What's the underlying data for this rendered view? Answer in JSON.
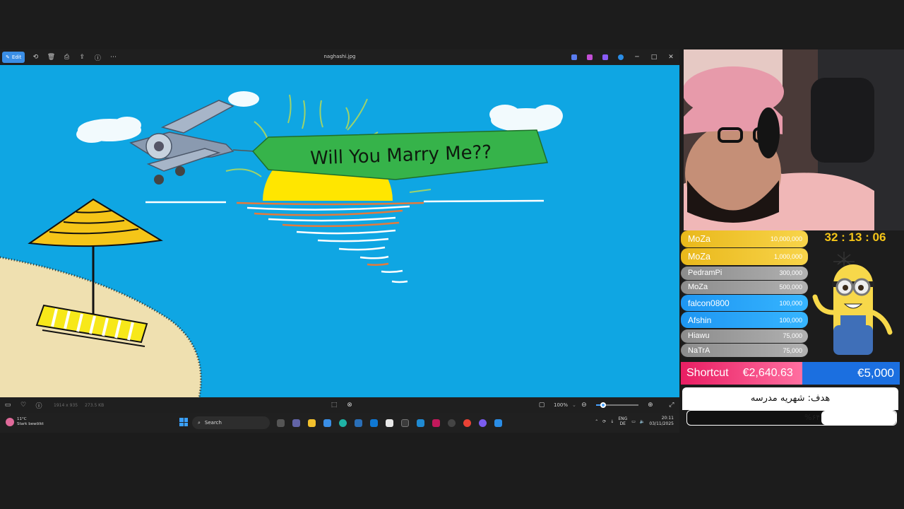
{
  "photos": {
    "edit_label": "Edit",
    "filename": "naghashi.jpg",
    "toolbar_icons": [
      "rotate-icon",
      "delete-icon",
      "print-icon",
      "share-icon",
      "info-icon",
      "more-icon"
    ],
    "window_controls": {
      "minimize": "─",
      "maximize": "□",
      "close": "✕"
    }
  },
  "drawing": {
    "banner_text": "Will You Marry Me??",
    "colors": {
      "sky": "#0fa6e3",
      "sun": "#ffe600",
      "banner": "#36b34a",
      "sand": "#efe0b0"
    }
  },
  "statusbar": {
    "dimensions": "1914 x 935",
    "filesize": "273.5 KB",
    "zoom": "100%"
  },
  "taskbar": {
    "weather_temp": "11°C",
    "weather_desc": "Stark bewölkt",
    "search_placeholder": "Search",
    "lang_top": "ENG",
    "lang_bottom": "DE",
    "time": "20:11",
    "date": "03/11/2025"
  },
  "overlay": {
    "timer": "32 : 13 : 06",
    "donors": [
      {
        "name": "MoZa",
        "amount": "10,000,000",
        "tier": "gold"
      },
      {
        "name": "MoZa",
        "amount": "1,000,000",
        "tier": "gold"
      },
      {
        "name": "PedramPi",
        "amount": "300,000",
        "tier": "gray"
      },
      {
        "name": "MoZa",
        "amount": "500,000",
        "tier": "gray"
      },
      {
        "name": "falcon0800",
        "amount": "100,000",
        "tier": "blue"
      },
      {
        "name": "Afshin",
        "amount": "100,000",
        "tier": "blue"
      },
      {
        "name": "Hiawu",
        "amount": "75,000",
        "tier": "gray"
      },
      {
        "name": "NaTrA",
        "amount": "75,000",
        "tier": "gray"
      }
    ],
    "shortcut_label": "Shortcut",
    "raised": "€2,640.63",
    "target": "€5,000",
    "goal_title": "هدف: شهریه مدرسه",
    "goal_percent": "%۶۴",
    "goal_fraction": 0.64
  }
}
